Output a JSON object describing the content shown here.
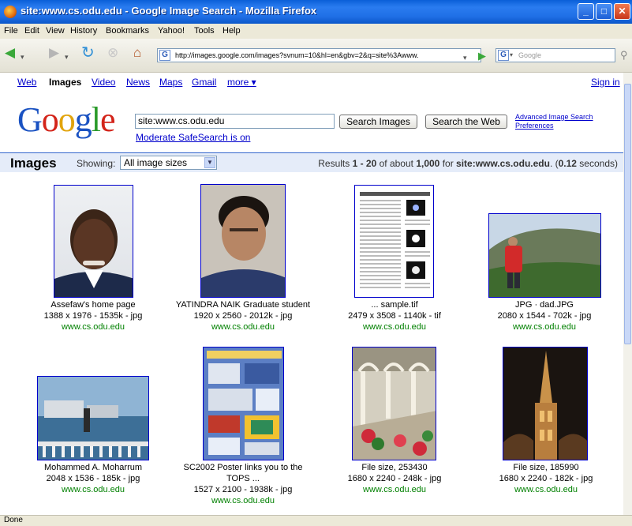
{
  "window": {
    "title": "site:www.cs.odu.edu - Google Image Search - Mozilla Firefox",
    "status": "Done"
  },
  "menu": [
    "File",
    "Edit",
    "View",
    "History",
    "Bookmarks",
    "Yahoo!",
    "Tools",
    "Help"
  ],
  "toolbar": {
    "url": "http://images.google.com/images?svnum=10&hl=en&gbv=2&q=site%3Awww.",
    "search_placeholder": "Google"
  },
  "gbar": {
    "links": [
      "Web",
      "Images",
      "Video",
      "News",
      "Maps",
      "Gmail",
      "more ▾"
    ],
    "sign_in": "Sign in"
  },
  "search": {
    "logo": "Google",
    "query": "site:www.cs.odu.edu",
    "btn_images": "Search Images",
    "btn_web": "Search the Web",
    "safe": "Moderate SafeSearch is on",
    "advanced": "Advanced Image Search",
    "preferences": "Preferences"
  },
  "results_bar": {
    "title": "Images",
    "showing": "Showing:",
    "size_option": "All image sizes",
    "stats_pre": "Results ",
    "range": "1 - 20",
    "of_about": " of about ",
    "count": "1,000",
    "for": " for ",
    "query": "site:www.cs.odu.edu",
    "time_pre": ". (",
    "time": "0.12",
    "time_post": " seconds)"
  },
  "results": [
    {
      "title": "Assefaw's home page",
      "meta": "1388 x 1976 - 1535k - jpg",
      "domain": "www.cs.odu.edu"
    },
    {
      "title": "YATINDRA NAIK Graduate student",
      "meta": "1920 x 2560 - 2012k - jpg",
      "domain": "www.cs.odu.edu"
    },
    {
      "title": "... sample.tif",
      "meta": "2479 x 3508 - 1140k - tif",
      "domain": "www.cs.odu.edu"
    },
    {
      "title": "JPG · dad.JPG",
      "meta": "2080 x 1544 - 702k - jpg",
      "domain": "www.cs.odu.edu"
    },
    {
      "title": "Mohammed A. Moharrum",
      "meta": "2048 x 1536 - 185k - jpg",
      "domain": "www.cs.odu.edu"
    },
    {
      "title": "SC2002 Poster links you to the",
      "title2": "TOPS ...",
      "meta": "1527 x 2100 - 1938k - jpg",
      "domain": "www.cs.odu.edu"
    },
    {
      "title": "File size, 253430",
      "meta": "1680 x 2240 - 248k - jpg",
      "domain": "www.cs.odu.edu"
    },
    {
      "title": "File size, 185990",
      "meta": "1680 x 2240 - 182k - jpg",
      "domain": "www.cs.odu.edu"
    }
  ]
}
